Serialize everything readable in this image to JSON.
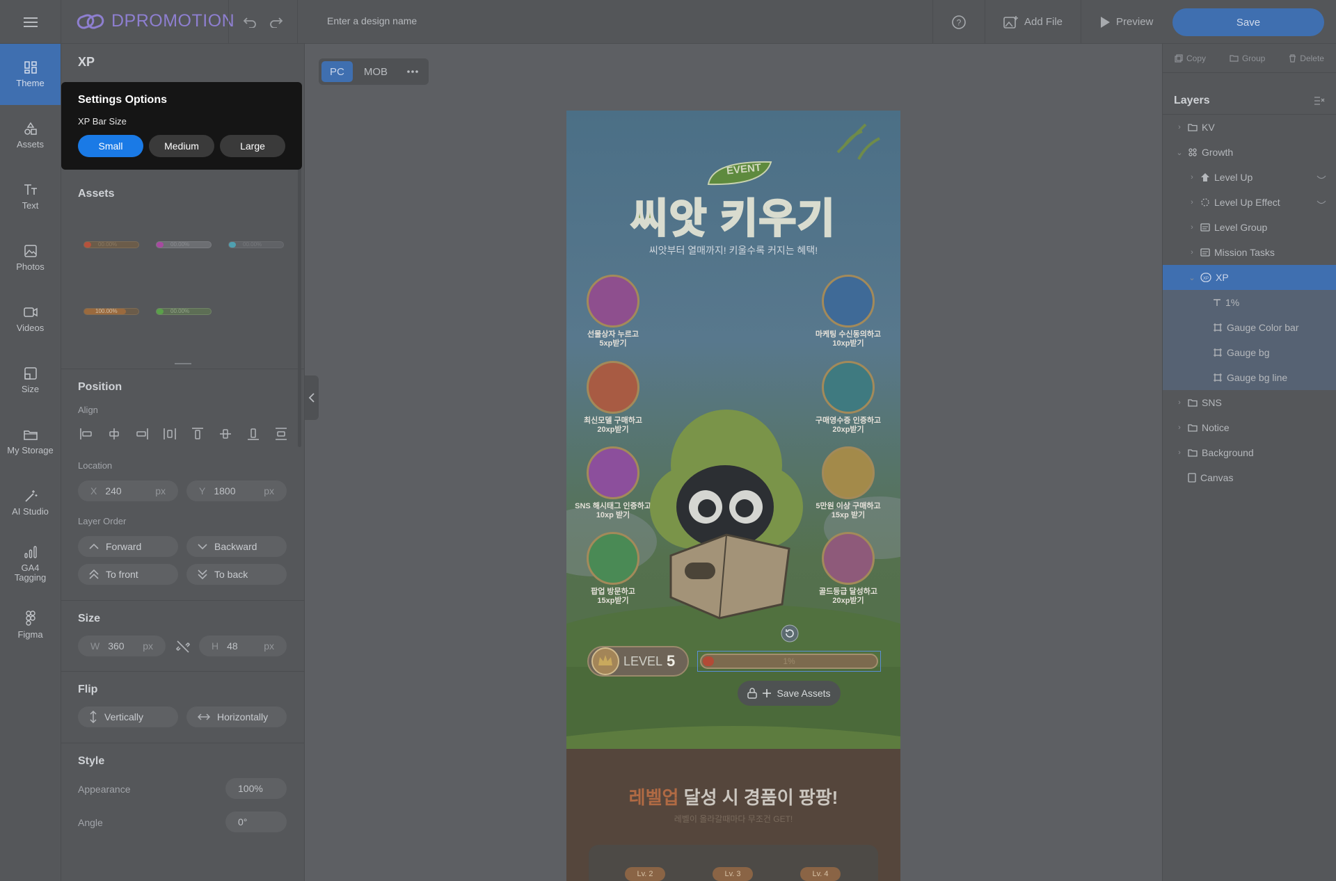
{
  "app": {
    "logo": "DPROMOTION",
    "design_name_placeholder": "Enter a design name"
  },
  "toolbar": {
    "add_file": "Add File",
    "preview": "Preview",
    "save": "Save"
  },
  "nav": [
    {
      "label": "Theme",
      "icon": "theme-icon"
    },
    {
      "label": "Assets",
      "icon": "assets-icon"
    },
    {
      "label": "Text",
      "icon": "text-icon"
    },
    {
      "label": "Photos",
      "icon": "photos-icon"
    },
    {
      "label": "Videos",
      "icon": "videos-icon"
    },
    {
      "label": "Size",
      "icon": "size-icon"
    },
    {
      "label": "My Storage",
      "icon": "folder-icon"
    },
    {
      "label": "AI Studio",
      "icon": "magic-wand-icon"
    },
    {
      "label": "GA4\nTagging",
      "icon": "analytics-icon"
    },
    {
      "label": "Figma",
      "icon": "figma-icon"
    }
  ],
  "panel": {
    "title": "XP",
    "popup": {
      "title": "Settings Options",
      "label": "XP Bar Size",
      "options": [
        "Small",
        "Medium",
        "Large"
      ],
      "selected": "Small"
    },
    "assets_title": "Assets",
    "asset_thumbs": [
      "00.00%",
      "00.00%",
      "00.00%",
      "100.00%",
      "00.00%"
    ],
    "position": {
      "title": "Position",
      "align_label": "Align",
      "location_label": "Location",
      "x_label": "X",
      "x": "240",
      "y_label": "Y",
      "y": "1800",
      "unit": "px"
    },
    "layer_order": {
      "label": "Layer Order",
      "forward": "Forward",
      "backward": "Backward",
      "to_front": "To front",
      "to_back": "To back"
    },
    "size": {
      "title": "Size",
      "w_label": "W",
      "w": "360",
      "h_label": "H",
      "h": "48",
      "unit": "px"
    },
    "flip": {
      "title": "Flip",
      "vertically": "Vertically",
      "horizontally": "Horizontally"
    },
    "style": {
      "title": "Style",
      "appearance_label": "Appearance",
      "appearance": "100%",
      "angle_label": "Angle",
      "angle": "0°"
    }
  },
  "device_tabs": [
    "PC",
    "MOB"
  ],
  "design": {
    "event_badge": "EVENT",
    "title": "씨앗 키우기",
    "subtitle": "씨앗부터 열매까지! 키울수록 커지는 혜택!",
    "missions_left": [
      [
        "선물상자 누르고",
        "5xp받기"
      ],
      [
        "최신모델 구매하고",
        "20xp받기"
      ],
      [
        "SNS 해시태그 인증하고",
        "10xp 받기"
      ],
      [
        "팝업 방문하고",
        "15xp받기"
      ]
    ],
    "missions_right": [
      [
        "마케팅 수신동의하고",
        "10xp받기"
      ],
      [
        "구매영수증 인증하고",
        "20xp받기"
      ],
      [
        "5만원 이상 구매하고",
        "15xp 받기"
      ],
      [
        "골드등급 달성하고",
        "20xp받기"
      ]
    ],
    "level_text": "LEVEL",
    "level_num": "5",
    "xp_percent": "1%",
    "xp_fill": 0.01,
    "save_assets": "Save Assets",
    "bottom_title_hl": "레벨업",
    "bottom_title_rest": " 달성 시 경품이 팡팡!",
    "bottom_sub": "레벨이 올라갈때마다 무조건 GET!",
    "level_tags": [
      "Lv. 2",
      "Lv. 3",
      "Lv. 4"
    ]
  },
  "right": {
    "tools": [
      "Copy",
      "Group",
      "Delete"
    ],
    "layers_title": "Layers",
    "layers": [
      {
        "name": "KV",
        "depth": 0,
        "caret": "›",
        "icon": "folder"
      },
      {
        "name": "Growth",
        "depth": 0,
        "caret": "⌄",
        "icon": "group"
      },
      {
        "name": "Level Up",
        "depth": 1,
        "caret": "›",
        "icon": "shape"
      },
      {
        "name": "Level Up Effect",
        "depth": 1,
        "caret": "›",
        "icon": "effect"
      },
      {
        "name": "Level Group",
        "depth": 1,
        "caret": "›",
        "icon": "frame"
      },
      {
        "name": "Mission Tasks",
        "depth": 1,
        "caret": "›",
        "icon": "frame"
      },
      {
        "name": "XP",
        "depth": 1,
        "caret": "⌄",
        "icon": "xp",
        "state": "sel"
      },
      {
        "name": "1%",
        "depth": 2,
        "caret": "",
        "icon": "text",
        "state": "grp"
      },
      {
        "name": "Gauge Color bar",
        "depth": 2,
        "caret": "",
        "icon": "rect",
        "state": "grp"
      },
      {
        "name": "Gauge bg",
        "depth": 2,
        "caret": "",
        "icon": "rect",
        "state": "grp"
      },
      {
        "name": "Gauge bg line",
        "depth": 2,
        "caret": "",
        "icon": "rect",
        "state": "grp"
      },
      {
        "name": "SNS",
        "depth": 0,
        "caret": "›",
        "icon": "folder"
      },
      {
        "name": "Notice",
        "depth": 0,
        "caret": "›",
        "icon": "folder"
      },
      {
        "name": "Background",
        "depth": 0,
        "caret": "›",
        "icon": "folder"
      },
      {
        "name": "Canvas",
        "depth": 0,
        "caret": "",
        "icon": "page"
      }
    ]
  }
}
